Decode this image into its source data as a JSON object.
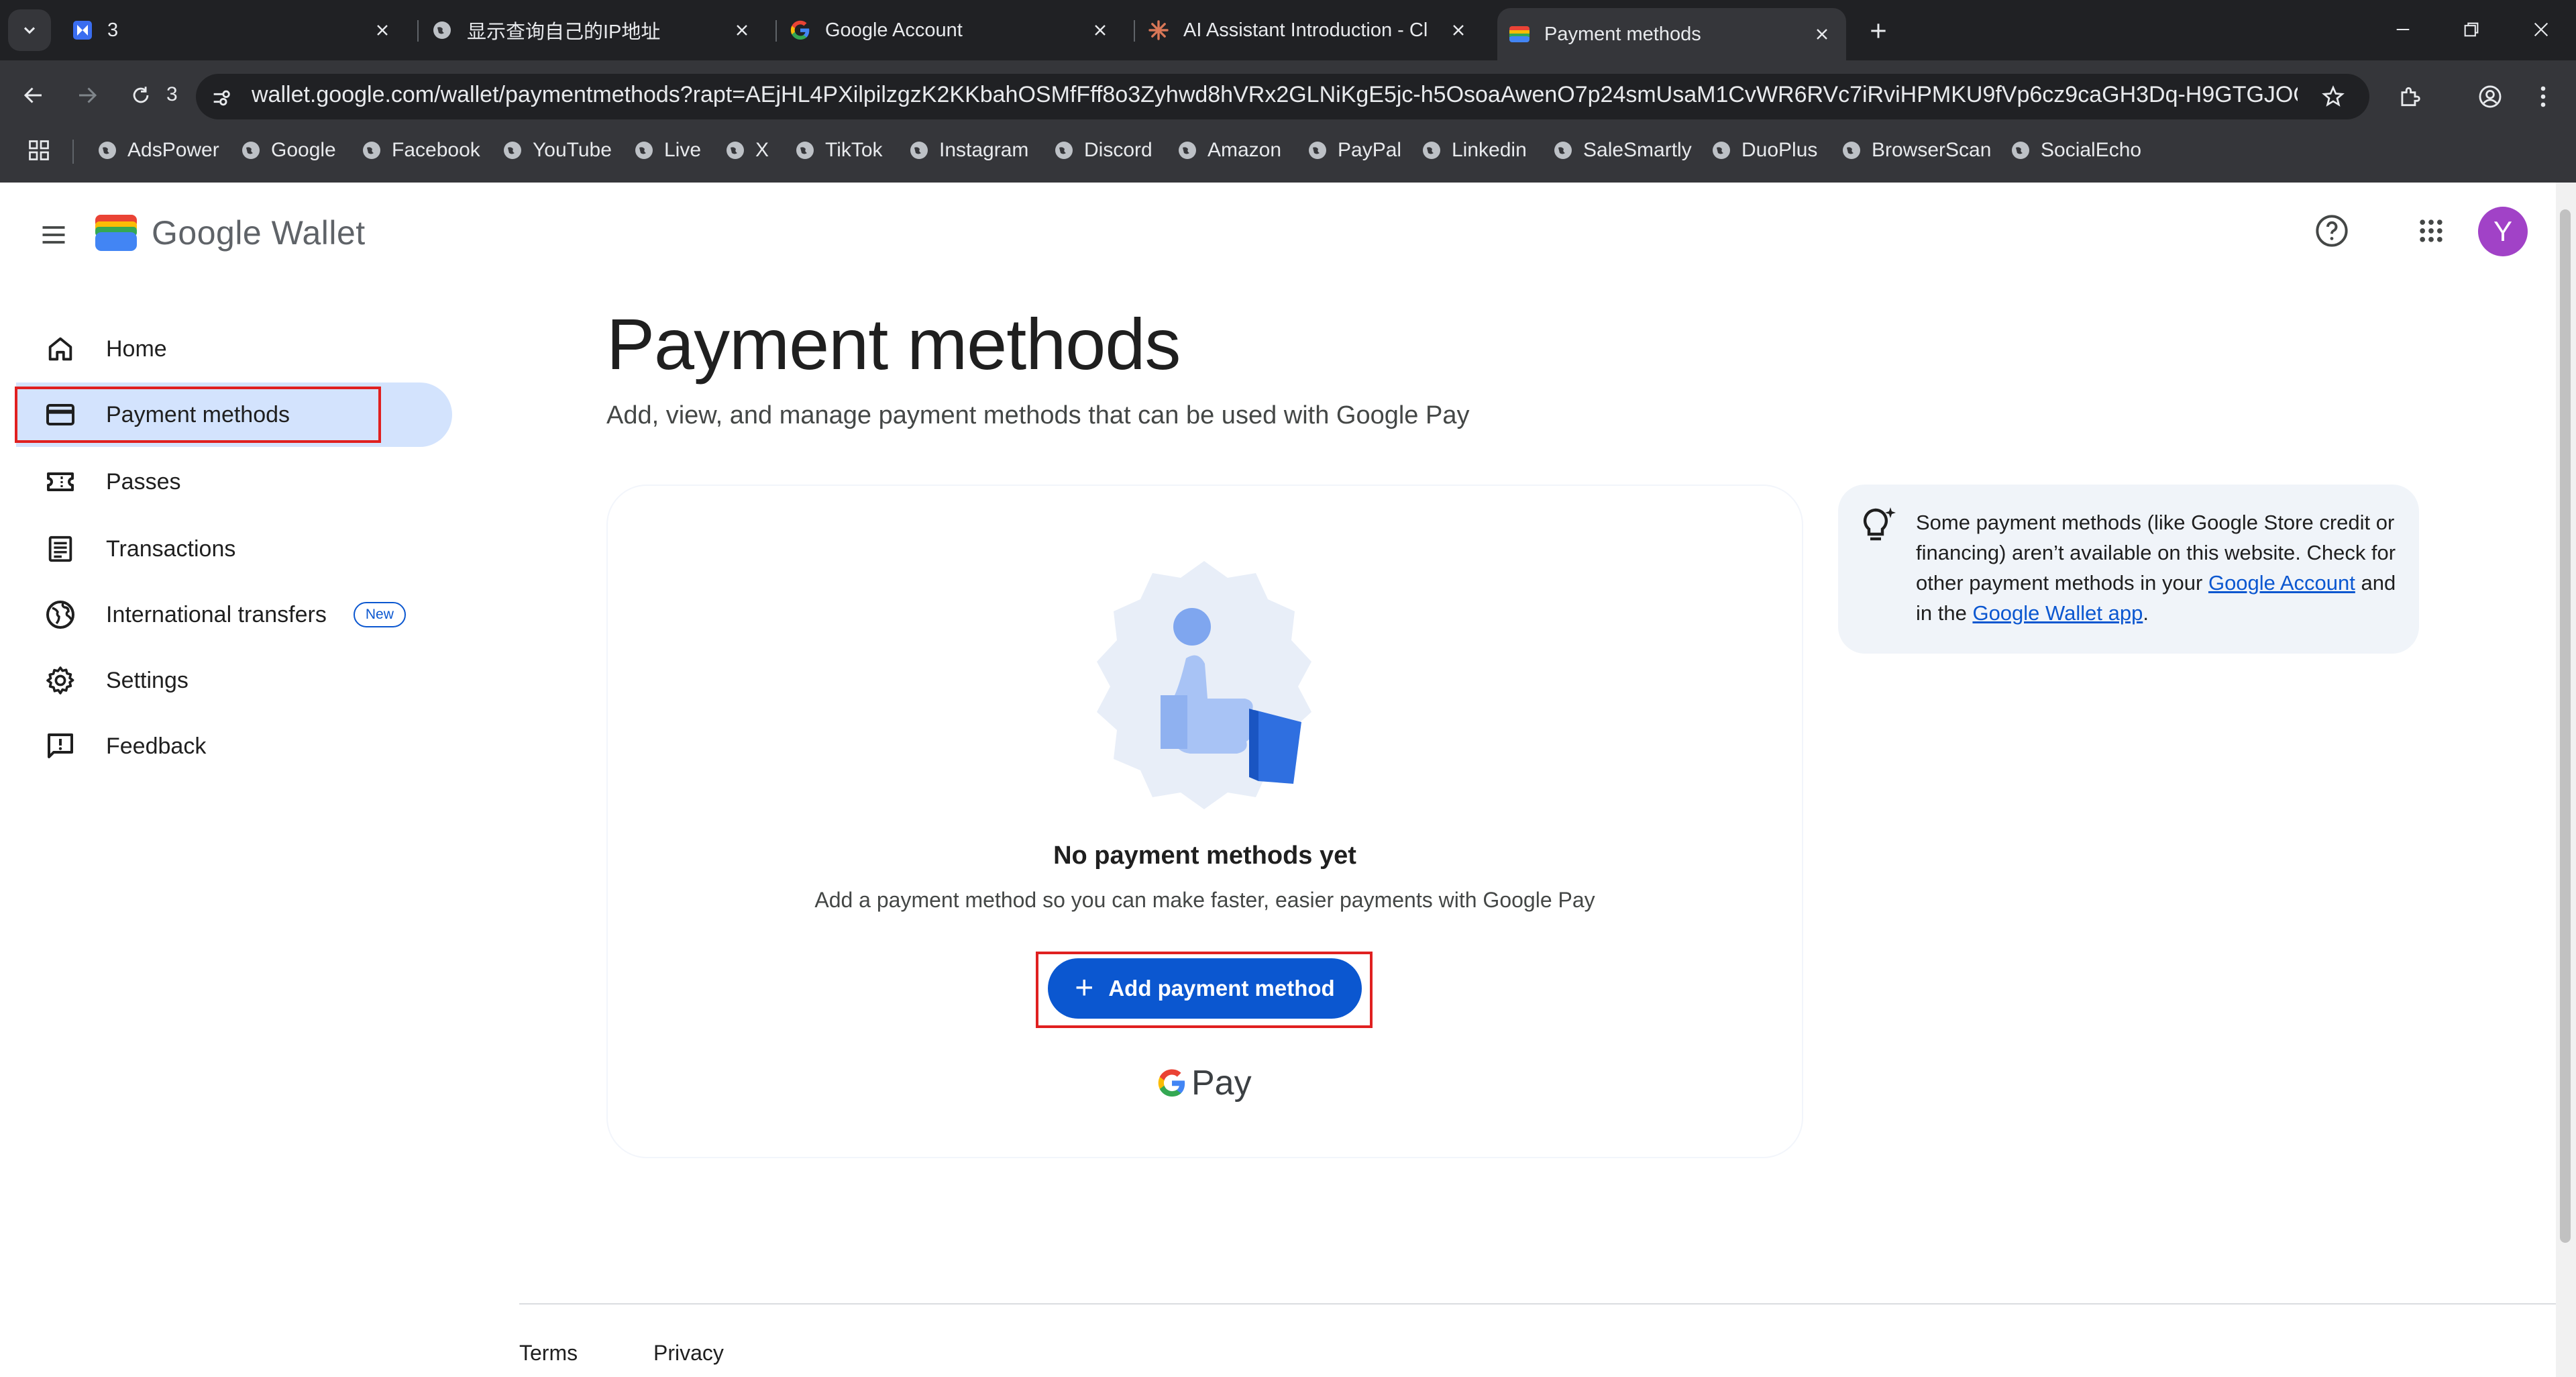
{
  "browser": {
    "tabs": [
      {
        "title": "3",
        "favicon": "remote-desktop-icon"
      },
      {
        "title": "显示查询自己的IP地址",
        "favicon": "globe-icon"
      },
      {
        "title": "Google Account",
        "favicon": "google-g-icon"
      },
      {
        "title": "AI Assistant Introduction - Cl",
        "favicon": "claude-icon"
      },
      {
        "title": "Payment methods",
        "favicon": "google-wallet-icon"
      }
    ],
    "active_tab": 4,
    "reload_count": "3",
    "url": "wallet.google.com/wallet/paymentmethods?rapt=AEjHL4PXilpilzgzK2KKbahOSMfFff8o3Zyhwd8hVRx2GLNiKgE5jc-h5OsoaAwenO7p24smUsaM1CvWR6RVc7iRviHPMKU9fVp6cz9caGH3Dq-H9GTGJOQ&...",
    "bookmarks": [
      "AdsPower",
      "Google",
      "Facebook",
      "YouTube",
      "Live",
      "X",
      "TikTok",
      "Instagram",
      "Discord",
      "Amazon",
      "PayPal",
      "Linkedin",
      "SaleSmartly",
      "DuoPlus",
      "BrowserScan",
      "SocialEcho"
    ]
  },
  "app": {
    "logo_text": "Google Wallet",
    "avatar_letter": "Y",
    "avatar_color": "#a142c7"
  },
  "sidebar": {
    "items": [
      {
        "label": "Home",
        "icon": "home-icon"
      },
      {
        "label": "Payment methods",
        "icon": "credit-card-icon"
      },
      {
        "label": "Passes",
        "icon": "ticket-icon"
      },
      {
        "label": "Transactions",
        "icon": "receipt-icon"
      },
      {
        "label": "International transfers",
        "icon": "globe-icon",
        "badge": "New"
      },
      {
        "label": "Settings",
        "icon": "gear-icon"
      },
      {
        "label": "Feedback",
        "icon": "feedback-icon"
      }
    ],
    "selected": 1
  },
  "main": {
    "title": "Payment methods",
    "subtitle": "Add, view, and manage payment methods that can be used with Google Pay",
    "empty_title": "No payment methods yet",
    "empty_subtitle": "Add a payment method so you can make faster, easier payments with Google Pay",
    "add_button": "Add payment method",
    "gpay_text": "Pay"
  },
  "tip": {
    "text_1": "Some payment methods (like Google Store credit or financing) aren’t available on this website. Check for other payment methods in your ",
    "link_1": "Google Account",
    "text_2": " and in the ",
    "link_2": "Google Wallet app",
    "text_3": "."
  },
  "footer": {
    "terms": "Terms",
    "privacy": "Privacy"
  },
  "colors": {
    "accent": "#0b57d0",
    "selected_nav": "#d3e3fd",
    "highlight_box": "#e02020"
  }
}
